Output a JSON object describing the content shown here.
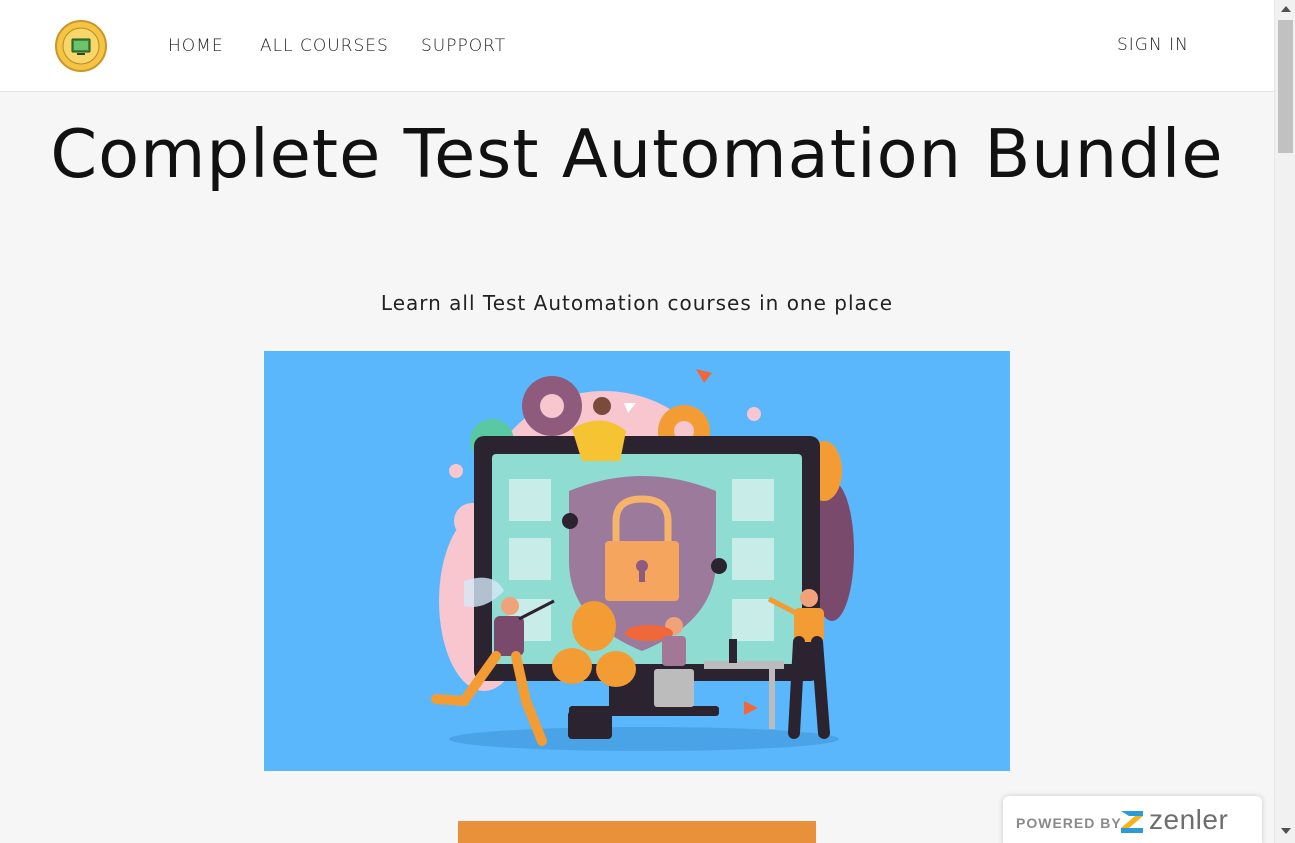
{
  "nav": {
    "items": [
      {
        "label": "HOME"
      },
      {
        "label": "ALL COURSES"
      },
      {
        "label": "SUPPORT"
      }
    ],
    "sign_in": "SIGN IN"
  },
  "hero": {
    "title": "Complete Test Automation Bundle",
    "subtitle": "Learn all Test Automation courses in one place"
  },
  "footer_badge": {
    "powered_by": "POWERED BY",
    "brand": "zenler"
  },
  "colors": {
    "banner_bg": "#5ab7fb",
    "cta": "#e8913a",
    "page_bg": "#f6f6f6"
  },
  "icons": {
    "logo": "site-logo",
    "banner": "security-illustration",
    "zenler": "zenler-logo-icon"
  }
}
